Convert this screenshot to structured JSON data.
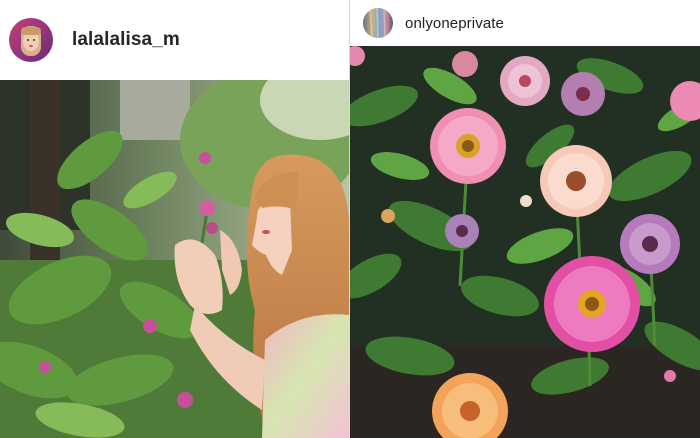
{
  "posts": [
    {
      "username": "lalalalisa_m",
      "avatar_icon": "profile-avatar",
      "photo_icon": "woman-smelling-flowers-photo"
    },
    {
      "username": "onlyoneprivate",
      "avatar_icon": "profile-avatar",
      "photo_icon": "zinnia-flower-garden-photo"
    }
  ],
  "colors": {
    "username_text": "#262626",
    "background": "#ffffff",
    "divider": "#d8d8d8"
  }
}
